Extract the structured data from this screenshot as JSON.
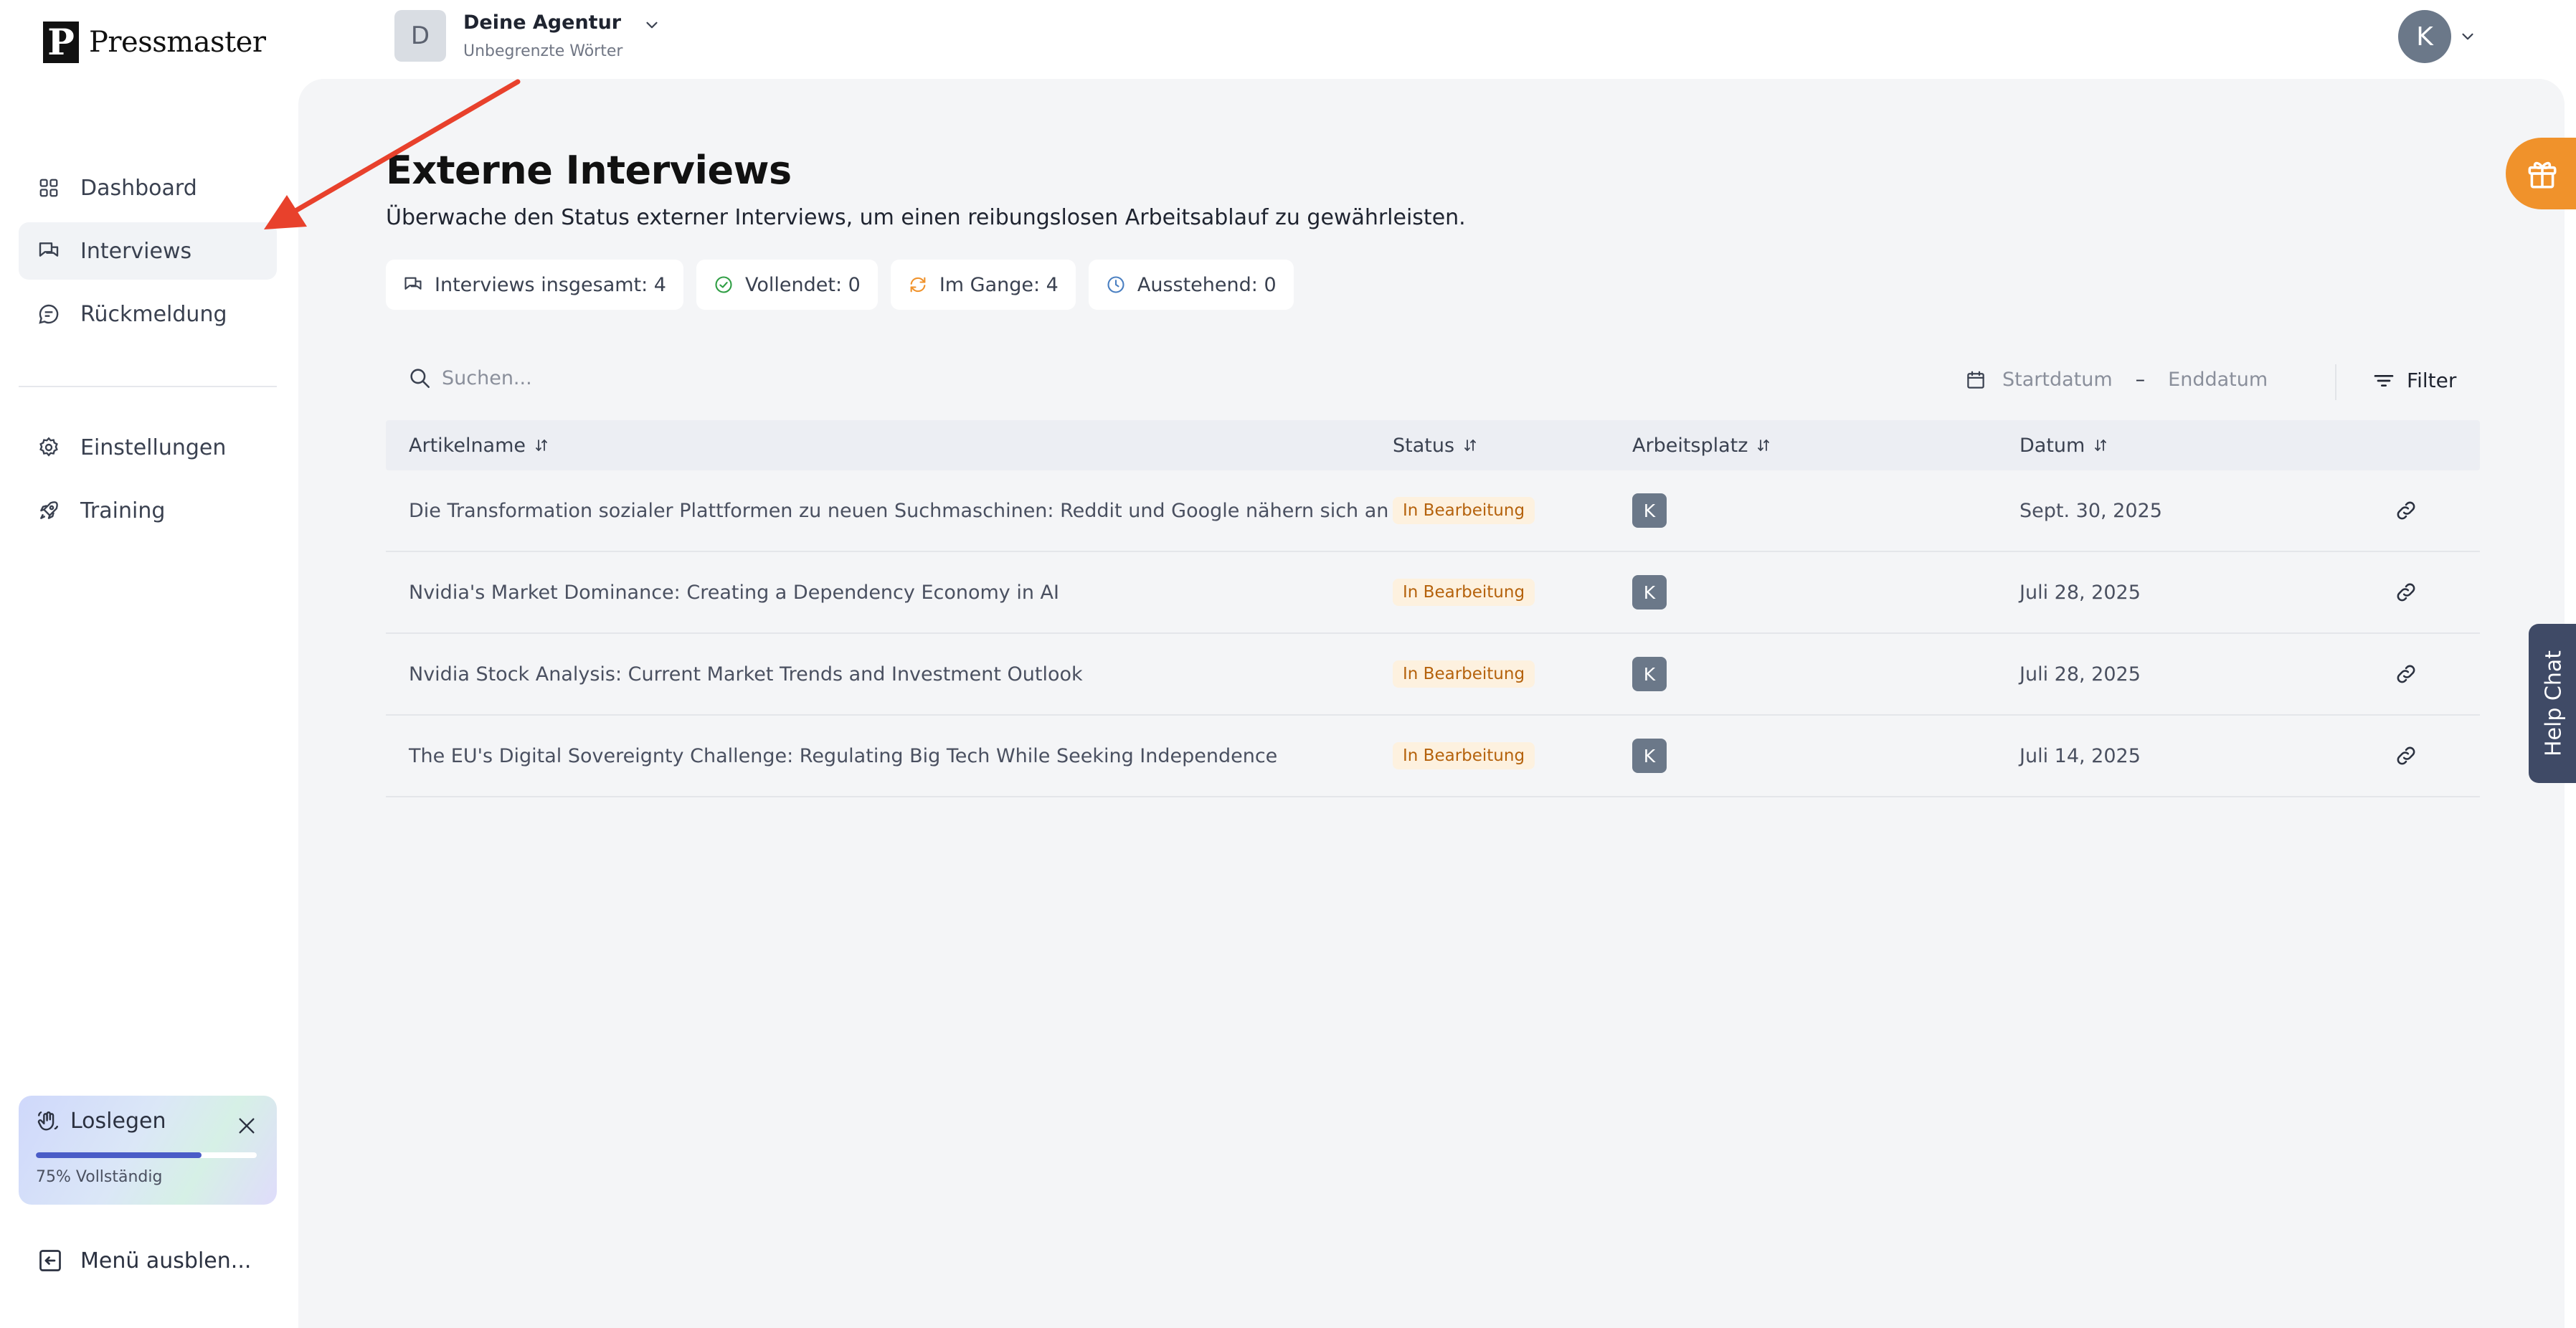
{
  "app": {
    "name": "Pressmaster",
    "logo_letter": "P"
  },
  "header": {
    "agency_initial": "D",
    "agency_name": "Deine Agentur",
    "agency_plan": "Unbegrenzte Wörter",
    "user_initial": "K"
  },
  "sidebar": {
    "items": [
      {
        "label": "Dashboard",
        "icon": "grid-icon",
        "active": false
      },
      {
        "label": "Interviews",
        "icon": "chat-bubbles-icon",
        "active": true
      },
      {
        "label": "Rückmeldung",
        "icon": "message-circle-icon",
        "active": false
      },
      {
        "label": "Einstellungen",
        "icon": "gear-icon",
        "active": false
      },
      {
        "label": "Training",
        "icon": "rocket-icon",
        "active": false
      }
    ],
    "onboarding": {
      "title": "Loslegen",
      "progress": 0.75,
      "progress_label": "75% Vollständig"
    },
    "hide_menu_label": "Menü ausblen..."
  },
  "main": {
    "title": "Externe Interviews",
    "subtitle": "Überwache den Status externer Interviews, um einen reibungslosen Arbeitsablauf zu gewährleisten.",
    "stats": [
      {
        "label": "Interviews insgesamt: 4",
        "icon": "chat-bubbles-icon"
      },
      {
        "label": "Vollendet: 0",
        "icon": "check-circle-icon"
      },
      {
        "label": "Im Gange: 4",
        "icon": "refresh-icon"
      },
      {
        "label": "Ausstehend: 0",
        "icon": "clock-icon"
      }
    ],
    "search": {
      "placeholder": "Suchen...",
      "value": ""
    },
    "date_range": {
      "start_placeholder": "Startdatum",
      "separator": "–",
      "end_placeholder": "Enddatum"
    },
    "filter_label": "Filter",
    "table": {
      "columns": [
        "Artikelname",
        "Status",
        "Arbeitsplatz",
        "Datum"
      ],
      "rows": [
        {
          "title": "Die Transformation sozialer Plattformen zu neuen Suchmaschinen: Reddit und Google nähern sich an",
          "status": "In Bearbeitung",
          "workspace": "K",
          "date": "Sept. 30, 2025"
        },
        {
          "title": "Nvidia's Market Dominance: Creating a Dependency Economy in AI",
          "status": "In Bearbeitung",
          "workspace": "K",
          "date": "Juli 28, 2025"
        },
        {
          "title": "Nvidia Stock Analysis: Current Market Trends and Investment Outlook",
          "status": "In Bearbeitung",
          "workspace": "K",
          "date": "Juli 28, 2025"
        },
        {
          "title": "The EU's Digital Sovereignty Challenge: Regulating Big Tech While Seeking Independence",
          "status": "In Bearbeitung",
          "workspace": "K",
          "date": "Juli 14, 2025"
        }
      ]
    }
  },
  "floating": {
    "help_chat_label": "Help Chat",
    "gift_icon": "gift-icon"
  },
  "colors": {
    "accent_orange": "#f0922b",
    "status_badge_bg": "#fdf1df",
    "status_badge_text": "#b5620c",
    "arrow_red": "#e8412c",
    "progress_blue": "#4a5cc7"
  }
}
